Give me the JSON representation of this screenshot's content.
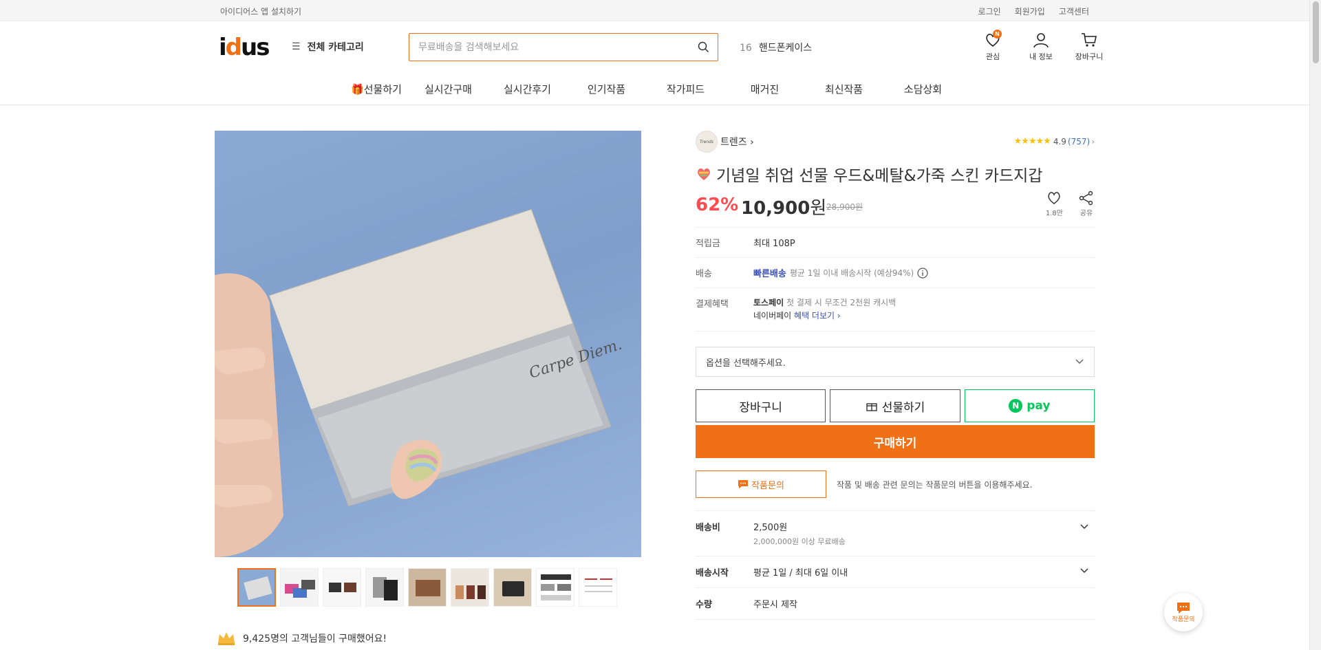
{
  "topbar": {
    "app_install": "아이디어스 앱 설치하기",
    "login": "로그인",
    "signup": "회원가입",
    "customer_center": "고객센터"
  },
  "header": {
    "logo": "idus",
    "category": "전체 카테고리",
    "search_placeholder": "무료배송을 검색해보세요",
    "trend_rank": "16",
    "trend_keyword": "핸드폰케이스",
    "icons": {
      "wishlist": "관심",
      "wishlist_badge": "N",
      "my_info": "내 정보",
      "cart": "장바구니"
    }
  },
  "nav": {
    "items": [
      "선물하기",
      "실시간구매",
      "실시간후기",
      "인기작품",
      "작가피드",
      "매거진",
      "최신작품",
      "소담상회"
    ]
  },
  "product": {
    "engraving_text": "Carpe Diem.",
    "artist_logo": "Trends",
    "artist": "트렌즈",
    "rating_stars": "★★★★★",
    "rating": "4.9",
    "review_count": "(757)",
    "title": "기념일 취업 선물 우드&메탈&가죽 스킨 카드지갑",
    "discount": "62%",
    "price": "10,900",
    "price_unit": "원",
    "original_price": "28,900원",
    "likes": "1.8만",
    "share": "공유",
    "points_label": "적립금",
    "points_value": "최대 108P",
    "delivery_label": "배송",
    "delivery_fast": "빠른배송",
    "delivery_desc": "평균 1일 이내 배송시작 (예상94%)",
    "payment_label": "결제혜택",
    "payment_toss": "토스페이",
    "payment_toss_desc": "첫 결제 시 무조건 2천원 캐시백",
    "payment_naver": "네이버페이",
    "payment_more": "혜택 더보기",
    "option_placeholder": "옵션을 선택해주세요.",
    "btn_cart": "장바구니",
    "btn_gift": "선물하기",
    "btn_npay": "pay",
    "btn_buy": "구매하기",
    "btn_inquiry": "작품문의",
    "inquiry_desc": "작품 및 배송 관련 문의는 작품문의 버튼을 이용해주세요.",
    "shipping_fee_label": "배송비",
    "shipping_fee": "2,500원",
    "shipping_free": "2,000,000원 이상 무료배송",
    "ship_start_label": "배송시작",
    "ship_start": "평균 1일 / 최대 6일 이내",
    "quantity_label": "수량",
    "quantity": "주문시 제작",
    "buyers": "9,425명의 고객님들이 구매했어요!"
  },
  "float": {
    "inquiry": "작품문의"
  },
  "colors": {
    "brand": "#f07016",
    "discount": "#ff4b50",
    "npay": "#03c75a",
    "link_blue": "#3b4fb3"
  }
}
